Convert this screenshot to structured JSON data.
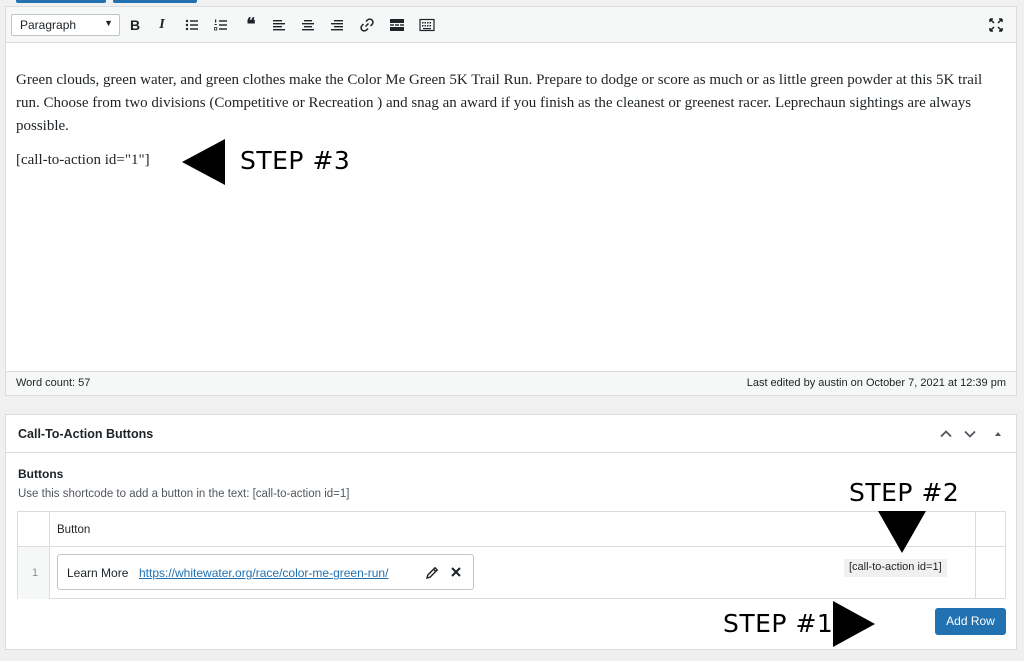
{
  "toolbar": {
    "format_value": "Paragraph",
    "buttons": [
      "bold-icon",
      "italic-icon",
      "bulleted-list-icon",
      "numbered-list-icon",
      "blockquote-icon",
      "align-left-icon",
      "align-center-icon",
      "align-right-icon",
      "link-icon",
      "read-more-icon",
      "toolbar-toggle-icon"
    ],
    "bold_glyph": "B",
    "italic_glyph": "I",
    "quote_glyph": "❝"
  },
  "editor": {
    "paragraph": "Green clouds, green water, and green clothes make the Color Me Green 5K Trail Run. Prepare to dodge or score as much or as little green powder at this 5K trail run. Choose from two divisions (Competitive or Recreation ) and snag an award if you finish as the cleanest or greenest racer. Leprechaun sightings are always possible.",
    "shortcode": "[call-to-action id=\"1\"]"
  },
  "status": {
    "word_count": "Word count: 57",
    "last_edited": "Last edited by austin on October 7, 2021 at 12:39 pm"
  },
  "metabox": {
    "title": "Call-To-Action Buttons",
    "section_label": "Buttons",
    "description": "Use this shortcode to add a button in the text: [call-to-action id=1]",
    "column_header": "Button",
    "rows": [
      {
        "index": "1",
        "label": "Learn More",
        "url": "https://whitewater.org/race/color-me-green-run/",
        "shortcode": "[call-to-action id=1]"
      }
    ],
    "add_row_label": "Add Row"
  },
  "annotations": {
    "step1": "STEP #1",
    "step2": "STEP #2",
    "step3": "STEP #3"
  },
  "colors": {
    "accent": "#2271b1",
    "border": "#dcdcde",
    "background": "#f0f0f1"
  }
}
